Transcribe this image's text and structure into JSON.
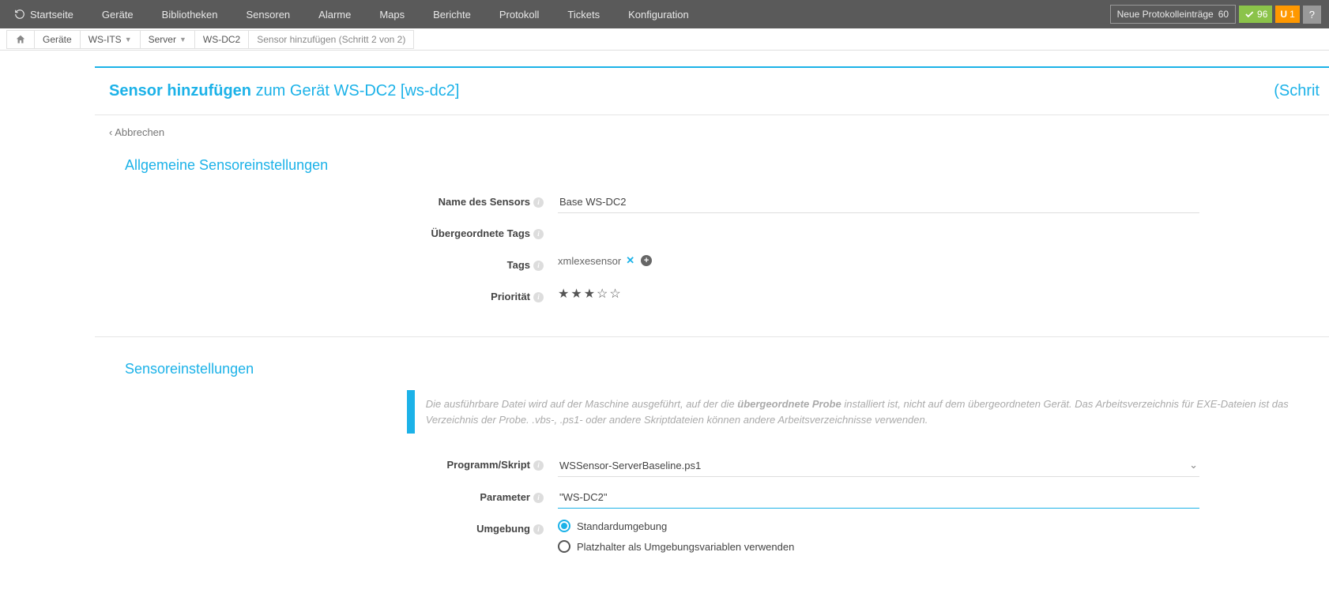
{
  "topnav": {
    "items": [
      "Startseite",
      "Geräte",
      "Bibliotheken",
      "Sensoren",
      "Alarme",
      "Maps",
      "Berichte",
      "Protokoll",
      "Tickets",
      "Konfiguration"
    ],
    "log_badge_label": "Neue Protokolleinträge",
    "log_badge_count": "60",
    "green_badge": "96",
    "orange_badge_letter": "U",
    "orange_badge_count": "1",
    "help": "?"
  },
  "breadcrumb": {
    "items": [
      "Geräte",
      "WS-ITS",
      "Server",
      "WS-DC2"
    ],
    "current": "Sensor hinzufügen (Schritt 2 von 2)"
  },
  "header": {
    "title_bold": "Sensor hinzufügen",
    "title_rest": "zum Gerät WS-DC2 [ws-dc2]",
    "step": "(Schrit"
  },
  "cancel": "Abbrechen",
  "sections": {
    "general": {
      "title": "Allgemeine Sensoreinstellungen",
      "name_label": "Name des Sensors",
      "name_value": "Base WS-DC2",
      "parent_tags_label": "Übergeordnete Tags",
      "tags_label": "Tags",
      "tag_value": "xmlexesensor",
      "priority_label": "Priorität",
      "priority_stars": 3,
      "priority_max": 5
    },
    "sensor": {
      "title": "Sensoreinstellungen",
      "callout_pre": "Die ausführbare Datei wird auf der Maschine ausgeführt, auf der die ",
      "callout_bold": "übergeordnete Probe",
      "callout_post": " installiert ist, nicht auf dem übergeordneten Gerät. Das Arbeitsverzeichnis für EXE-Dateien ist das Verzeichnis der Probe. .vbs-, .ps1- oder andere Skriptdateien können andere Arbeitsverzeichnisse verwenden.",
      "program_label": "Programm/Skript",
      "program_value": "WSSensor-ServerBaseline.ps1",
      "parameter_label": "Parameter",
      "parameter_value": "\"WS-DC2\"",
      "env_label": "Umgebung",
      "env_options": [
        "Standardumgebung",
        "Platzhalter als Umgebungsvariablen verwenden"
      ],
      "env_selected": 0
    }
  }
}
